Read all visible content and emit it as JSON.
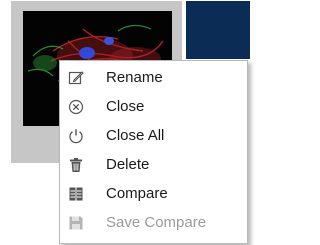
{
  "thumbnail": {
    "icon": "cell-micrograph-image"
  },
  "context_menu": {
    "items": [
      {
        "label": "Rename",
        "icon": "rename-icon",
        "enabled": true
      },
      {
        "label": "Close",
        "icon": "close-icon",
        "enabled": true
      },
      {
        "label": "Close All",
        "icon": "power-icon",
        "enabled": true
      },
      {
        "label": "Delete",
        "icon": "trash-icon",
        "enabled": true
      },
      {
        "label": "Compare",
        "icon": "compare-icon",
        "enabled": true
      },
      {
        "label": "Save Compare",
        "icon": "save-icon",
        "enabled": false
      }
    ]
  },
  "colors": {
    "menu_text": "#1a1a1a",
    "disabled_text": "#9a9a9a",
    "icon": "#555555",
    "thumbnail_frame": "#c6c6c6",
    "dark_panel": "#0b2d55"
  }
}
